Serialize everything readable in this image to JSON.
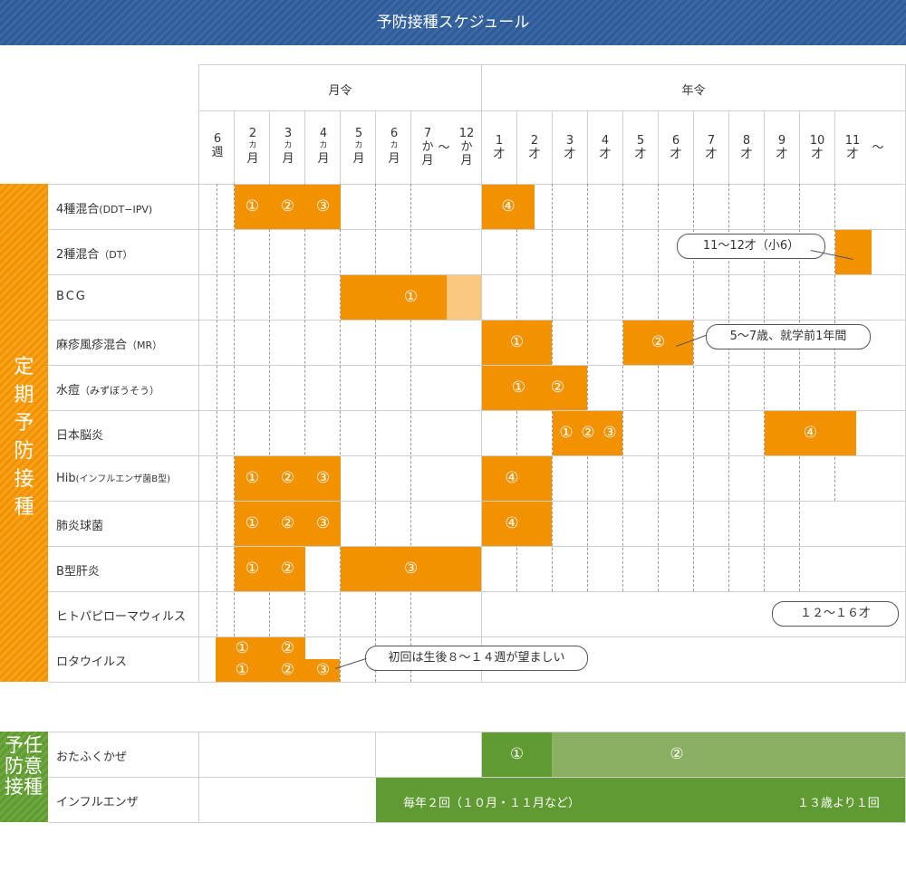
{
  "title": "予防接種スケジュール",
  "header": {
    "month_group": "月令",
    "year_group": "年令",
    "columns": [
      {
        "main": "6",
        "sub": "",
        "unit": "週"
      },
      {
        "main": "2",
        "sub": "カ",
        "unit": "月"
      },
      {
        "main": "3",
        "sub": "カ",
        "unit": "月"
      },
      {
        "main": "4",
        "sub": "カ",
        "unit": "月"
      },
      {
        "main": "5",
        "sub": "カ",
        "unit": "月"
      },
      {
        "main": "6",
        "sub": "カ",
        "unit": "月"
      },
      {
        "main": "7",
        "sub": "か",
        "unit": "月"
      },
      {
        "main": "〜",
        "sub": "",
        "unit": ""
      },
      {
        "main": "12",
        "sub": "か",
        "unit": "月"
      },
      {
        "main": "1",
        "sub": "",
        "unit": "才"
      },
      {
        "main": "2",
        "sub": "",
        "unit": "才"
      },
      {
        "main": "3",
        "sub": "",
        "unit": "才"
      },
      {
        "main": "4",
        "sub": "",
        "unit": "才"
      },
      {
        "main": "5",
        "sub": "",
        "unit": "才"
      },
      {
        "main": "6",
        "sub": "",
        "unit": "才"
      },
      {
        "main": "7",
        "sub": "",
        "unit": "才"
      },
      {
        "main": "8",
        "sub": "",
        "unit": "才"
      },
      {
        "main": "9",
        "sub": "",
        "unit": "才"
      },
      {
        "main": "10",
        "sub": "",
        "unit": "才"
      },
      {
        "main": "11",
        "sub": "",
        "unit": "才"
      },
      {
        "main": "〜",
        "sub": "",
        "unit": ""
      }
    ]
  },
  "regular": {
    "side_label": "定期予防接種",
    "rows": [
      {
        "label": "4種混合",
        "label_small": "(DDT−IPV)"
      },
      {
        "label": "2種混合",
        "label_small": "（DT）"
      },
      {
        "label": "BCG",
        "label_small": ""
      },
      {
        "label": "麻疹風疹混合",
        "label_small": "（MR）"
      },
      {
        "label": "水痘",
        "label_small": "（みずぼうそう）"
      },
      {
        "label": "日本脳炎",
        "label_small": ""
      },
      {
        "label": "Hib",
        "label_small": "(インフルエンザ菌B型)"
      },
      {
        "label": "肺炎球菌",
        "label_small": ""
      },
      {
        "label": "B型肝炎",
        "label_small": ""
      },
      {
        "label": "ヒトパピローマウィルス",
        "label_small": ""
      },
      {
        "label": "ロタウイルス",
        "label_small": ""
      }
    ]
  },
  "optional": {
    "side_label": "予任防意接種",
    "rows": [
      {
        "label": "おたふくかぜ"
      },
      {
        "label": "インフルエンザ"
      }
    ],
    "flu_note_left": "毎年２回（１０月・１１月など）",
    "flu_note_right": "１３歳より１回"
  },
  "doses": {
    "d1": "①",
    "d2": "②",
    "d3": "③",
    "d4": "④"
  },
  "notes": {
    "dt": "11〜12才（小6）",
    "mr": "5〜7歳、就学前1年間",
    "hpv": "１２〜１６才",
    "rota": "初回は生後８〜１４週が望ましい"
  },
  "colors": {
    "header_blue": "#2f5c96",
    "orange": "#f39200",
    "orange_light": "#fbc881",
    "green_dark": "#5f9b32",
    "green_light": "#88b060"
  }
}
